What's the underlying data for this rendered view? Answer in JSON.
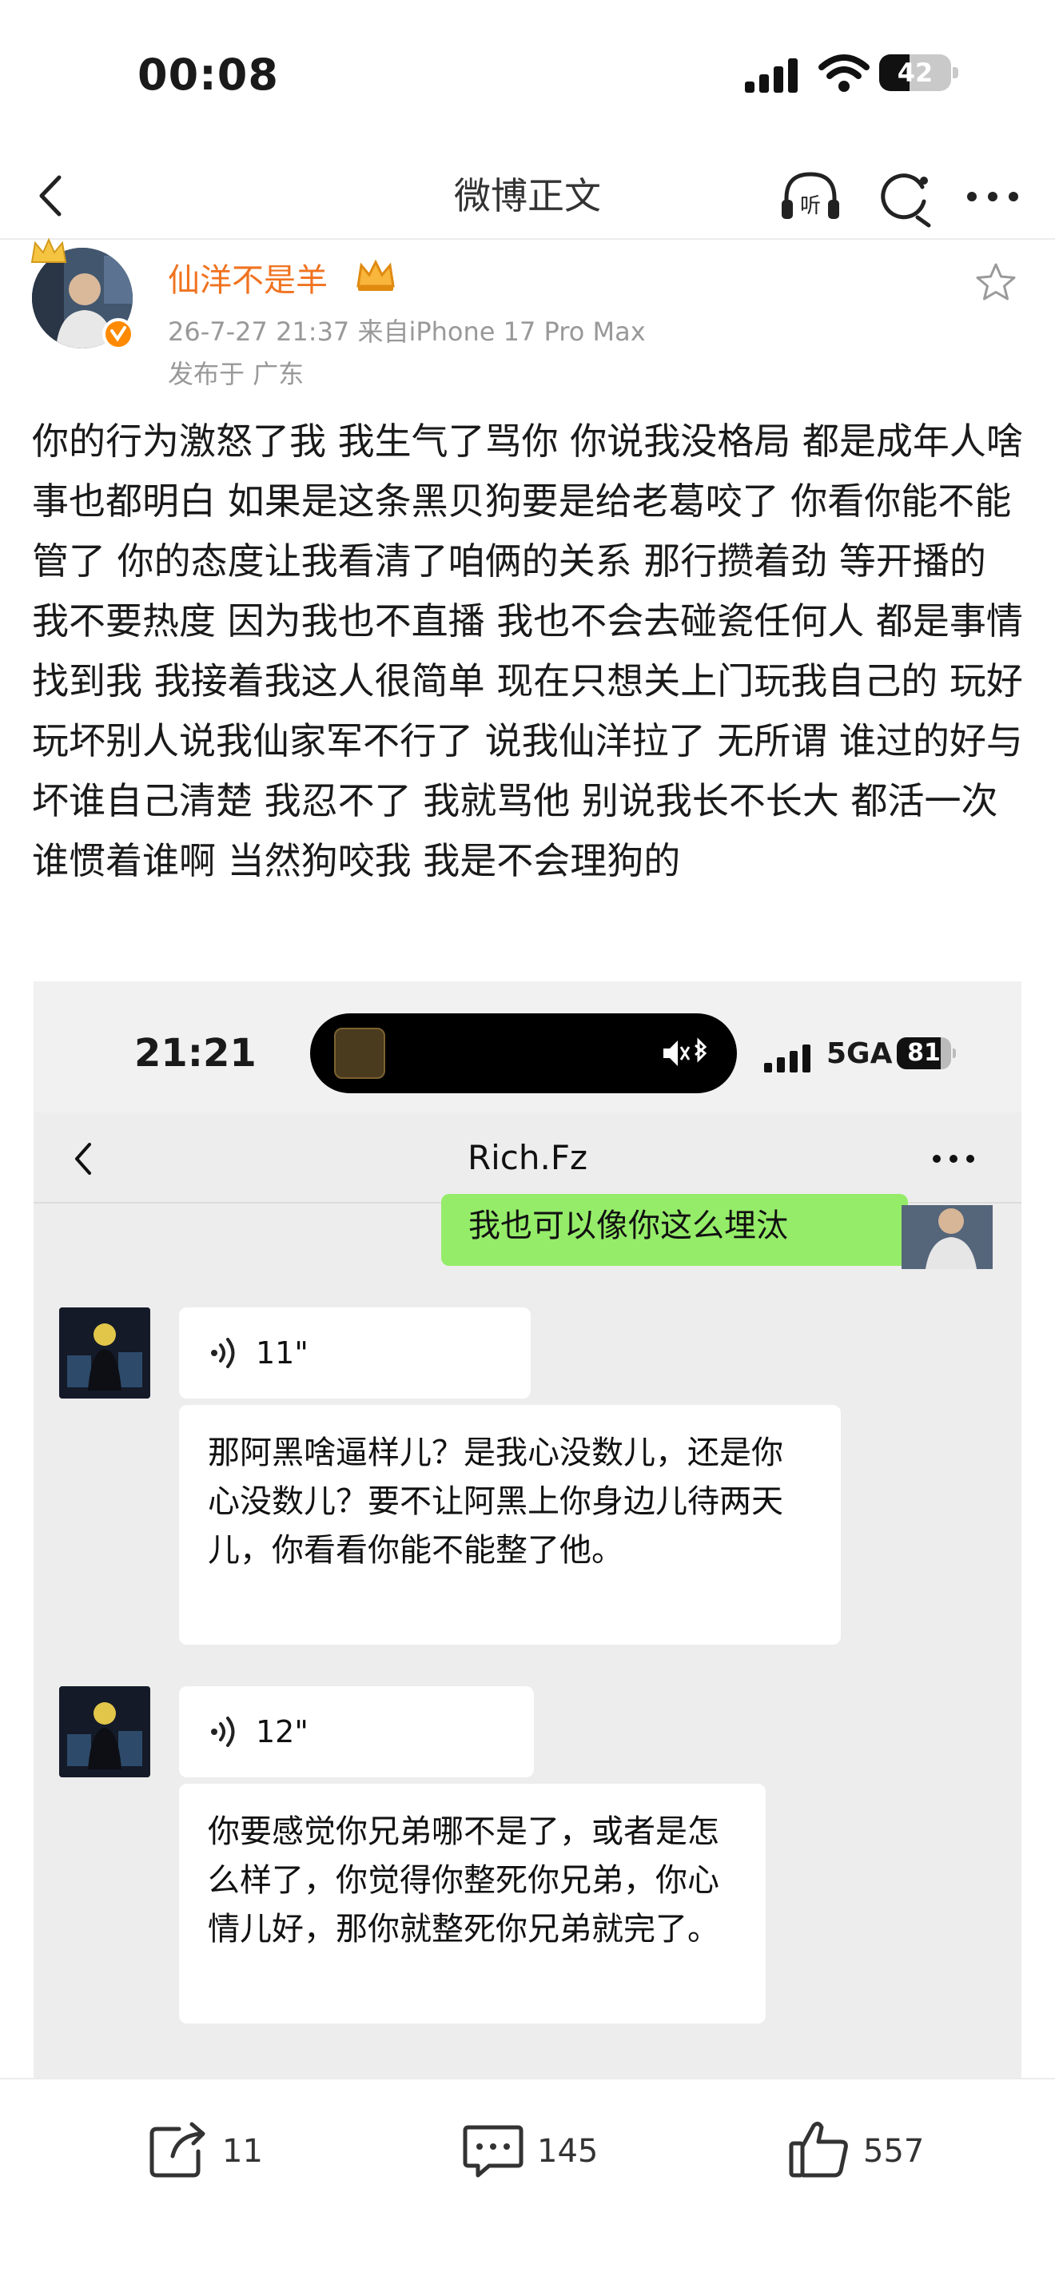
{
  "status_bar": {
    "time": "00:08",
    "battery": "42",
    "battery_level": 0.42
  },
  "nav": {
    "title": "微博正文",
    "listen_icon": "listen-icon",
    "refresh_icon": "refresh-icon"
  },
  "post": {
    "author": "仙洋不是羊",
    "meta": "26-7-27 21:37  来自iPhone 17 Pro Max",
    "location": "发布于 广东",
    "body": "你的行为激怒了我  我生气了骂你 你说我没格局 都是成年人啥事也都明白 如果是这条黑贝狗要是给老葛咬了 你看你能不能管了 你的态度让我看清了咱俩的关系 那行攒着劲 等开播的 我不要热度 因为我也不直播  我也不会去碰瓷任何人 都是事情找到我 我接着我这人很简单 现在只想关上门玩我自己的 玩好玩坏别人说我仙家军不行了 说我仙洋拉了 无所谓 谁过的好与坏谁自己清楚 我忍不了 我就骂他 别说我长不长大 都活一次谁惯着谁啊 当然狗咬我 我是不会理狗的"
  },
  "screenshot": {
    "status": {
      "time": "21:21",
      "network": "5GA",
      "battery": "81",
      "battery_level": 0.81
    },
    "chat_title": "Rich.Fz",
    "my_message": "我也可以像你这么埋汰",
    "messages": [
      {
        "voice": "11\"",
        "text": "那阿黑啥逼样儿？是我心没数儿，还是你心没数儿？要不让阿黑上你身边儿待两天儿，你看看你能不能整了他。"
      },
      {
        "voice": "12\"",
        "text": "你要感觉你兄弟哪不是了，或者是怎么样了，你觉得你整死你兄弟，你心情儿好，那你就整死你兄弟就完了。"
      }
    ]
  },
  "actions": {
    "repost": "11",
    "comments": "145",
    "likes": "557"
  },
  "colors": {
    "accent_orange": "#f07320",
    "wechat_green": "#95ec69",
    "meta_gray": "#999999"
  }
}
